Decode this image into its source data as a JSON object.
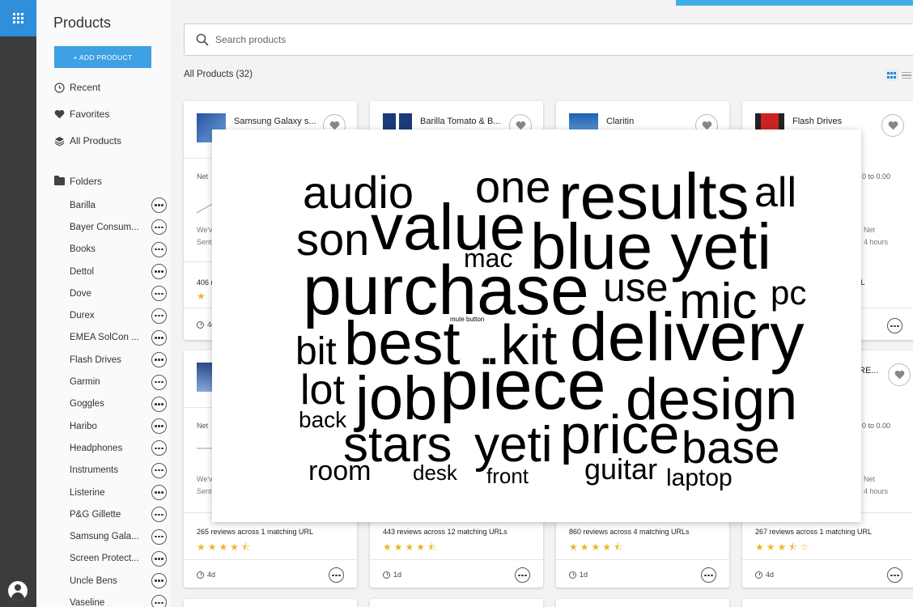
{
  "sidebar": {
    "title": "Products",
    "add_button": "+ ADD PRODUCT",
    "nav": {
      "recent": "Recent",
      "favorites": "Favorites",
      "all_products": "All Products"
    },
    "folders_label": "Folders",
    "folders": [
      "Barilla",
      "Bayer Consum...",
      "Books",
      "Dettol",
      "Dove",
      "Durex",
      "EMEA SolCon ...",
      "Flash Drives",
      "Garmin",
      "Goggles",
      "Haribo",
      "Headphones",
      "Instruments",
      "Listerine",
      "P&G Gillette",
      "Samsung Gala...",
      "Screen Protect...",
      "Uncle Bens",
      "Vaseline"
    ]
  },
  "search": {
    "placeholder": "Search products"
  },
  "main": {
    "count_label": "All Products (32)"
  },
  "cards_row1": [
    {
      "title": "Samsung Galaxy s...",
      "net": "Net ",
      "grey1": "We'v",
      "grey2": "Sent",
      "reviews": "406 r",
      "age": "4d"
    },
    {
      "title": "Barilla Tomato & B..."
    },
    {
      "title": "Claritin"
    },
    {
      "title": "Flash Drives",
      "net": "0 to 0.00",
      "grey1": "Net",
      "grey2": "4 hours",
      "reviews": "g URL"
    }
  ],
  "cards_row2": [
    {
      "net": "Net ",
      "grey1": "We'v",
      "grey2": "Sent",
      "reviews": "265 reviews across 1 matching URL",
      "stars": "★★★★⯪",
      "age": "4d"
    },
    {
      "reviews": "443 reviews across 12 matching URLs",
      "stars": "★★★★⯪",
      "age": "1d"
    },
    {
      "reviews": "860 reviews across 4 matching URLs",
      "stars": "★★★★⯪",
      "age": "1d"
    },
    {
      "title": "RE...",
      "net": "0 to 0.00",
      "grey1": "Net",
      "grey2": "4 hours",
      "reviews": "267 reviews across 1 matching URL",
      "stars": "★★★⯪☆",
      "age": "4d"
    }
  ],
  "wordcloud": {
    "colors": {
      "green": "#8cbf8c",
      "green_dark": "#7db07d",
      "red": "#d98a8a",
      "light": "#dddddd"
    },
    "words": [
      {
        "text": "audio",
        "color": "green"
      },
      {
        "text": "one",
        "color": "green"
      },
      {
        "text": "results",
        "color": "green"
      },
      {
        "text": "all",
        "color": "light"
      },
      {
        "text": "son",
        "color": "green"
      },
      {
        "text": "value",
        "color": "green"
      },
      {
        "text": "blue yeti",
        "color": "green"
      },
      {
        "text": "mac",
        "color": "green"
      },
      {
        "text": "purchase",
        "color": "green"
      },
      {
        "text": "use",
        "color": "green"
      },
      {
        "text": "mic",
        "color": "green"
      },
      {
        "text": "pc",
        "color": "green"
      },
      {
        "text": "mute button",
        "color": "light"
      },
      {
        "text": "bit",
        "color": "green"
      },
      {
        "text": "best",
        "color": "green"
      },
      {
        "text": ".kit",
        "color": "green"
      },
      {
        "text": "delivery",
        "color": "green"
      },
      {
        "text": "lot",
        "color": "green"
      },
      {
        "text": "job",
        "color": "green"
      },
      {
        "text": "piece",
        "color": "green"
      },
      {
        "text": "design",
        "color": "green"
      },
      {
        "text": "back",
        "color": "green"
      },
      {
        "text": "stars",
        "color": "green"
      },
      {
        "text": "yeti",
        "color": "green"
      },
      {
        "text": "price",
        "color": "red"
      },
      {
        "text": "base",
        "color": "green"
      },
      {
        "text": "room",
        "color": "red"
      },
      {
        "text": "desk",
        "color": "green"
      },
      {
        "text": "front",
        "color": "green"
      },
      {
        "text": "guitar",
        "color": "green"
      },
      {
        "text": "laptop",
        "color": "green"
      }
    ]
  }
}
